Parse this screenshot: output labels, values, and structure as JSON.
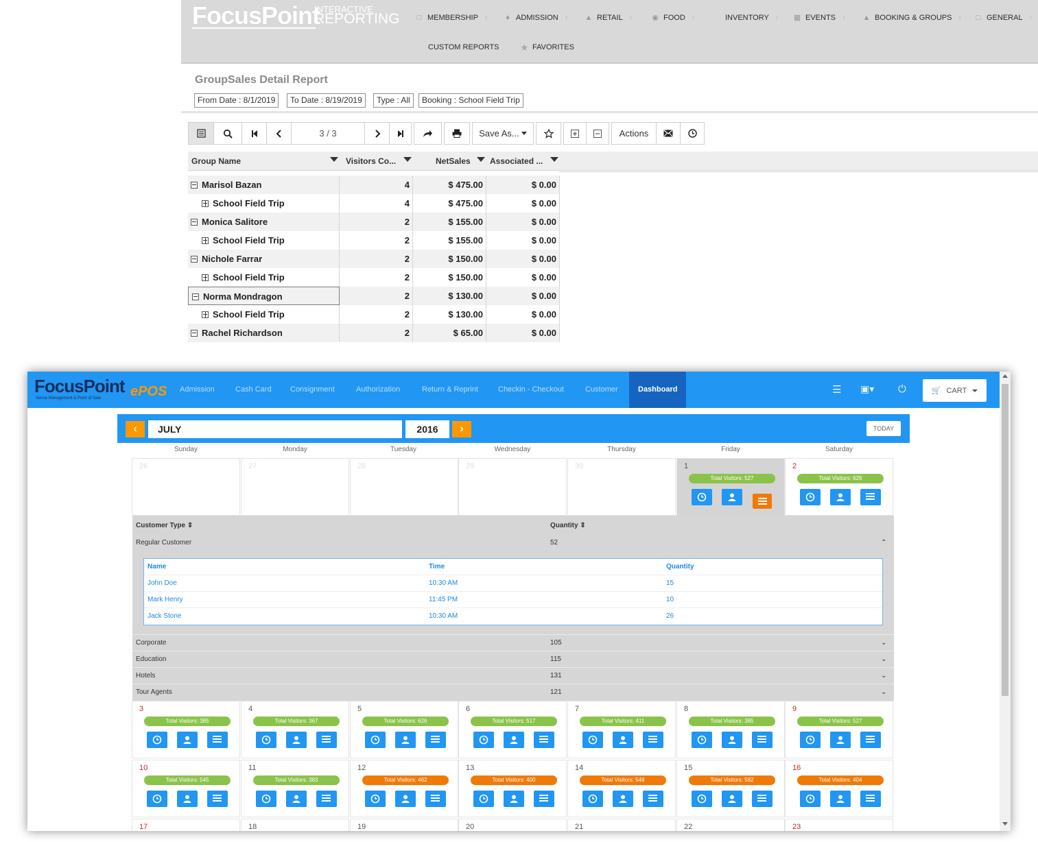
{
  "report": {
    "logo_main": "FocusPoint",
    "logo_small1": "INTERACTIVE",
    "logo_small2": "REPORTING",
    "nav": [
      {
        "label": "MEMBERSHIP",
        "icon": "membership-icon"
      },
      {
        "label": "ADMISSION",
        "icon": "ticket-icon"
      },
      {
        "label": "RETAIL",
        "icon": "shirt-icon"
      },
      {
        "label": "FOOD",
        "icon": "food-icon"
      },
      {
        "label": "INVENTORY",
        "icon": ""
      },
      {
        "label": "EVENTS",
        "icon": "calendar-icon"
      },
      {
        "label": "BOOKING & GROUPS",
        "icon": "booking-icon"
      },
      {
        "label": "GENERAL",
        "icon": "general-icon"
      }
    ],
    "nav2": [
      {
        "label": "CUSTOM REPORTS"
      },
      {
        "label": "FAVORITES",
        "icon": "star-icon"
      }
    ],
    "title": "GroupSales Detail Report",
    "filters": [
      "From Date : 8/1/2019",
      "To Date : 8/19/2019",
      "Type : All",
      "Booking : School Field Trip"
    ],
    "toolbar": {
      "page_current": "3",
      "page_sep": " / ",
      "page_total": "3",
      "save_as": "Save As...",
      "actions": "Actions"
    },
    "columns": [
      "Group Name",
      "Visitors Co...",
      "NetSales",
      "Associated ..."
    ],
    "rows": [
      {
        "type": "parent",
        "name": "Marisol Bazan",
        "visitors": "4",
        "net": "$ 475.00",
        "assoc": "$ 0.00"
      },
      {
        "type": "child",
        "name": "School Field Trip",
        "visitors": "4",
        "net": "$ 475.00",
        "assoc": "$ 0.00"
      },
      {
        "type": "parent",
        "name": "Monica Salitore",
        "visitors": "2",
        "net": "$ 155.00",
        "assoc": "$ 0.00"
      },
      {
        "type": "child",
        "name": "School Field Trip",
        "visitors": "2",
        "net": "$ 155.00",
        "assoc": "$ 0.00"
      },
      {
        "type": "parent",
        "name": "Nichole Farrar",
        "visitors": "2",
        "net": "$ 150.00",
        "assoc": "$ 0.00"
      },
      {
        "type": "child",
        "name": "School Field Trip",
        "visitors": "2",
        "net": "$ 150.00",
        "assoc": "$ 0.00"
      },
      {
        "type": "parent",
        "name": "Norma Mondragon",
        "visitors": "2",
        "net": "$ 130.00",
        "assoc": "$ 0.00"
      },
      {
        "type": "child",
        "name": "School Field Trip",
        "visitors": "2",
        "net": "$ 130.00",
        "assoc": "$ 0.00"
      },
      {
        "type": "parent",
        "name": "Rachel Richardson",
        "visitors": "2",
        "net": "$ 65.00",
        "assoc": "$ 0.00"
      }
    ]
  },
  "pos": {
    "logo_main": "FocusPoint",
    "logo_epos": "ePOS",
    "logo_sub": "Venue Management & Point of Sale",
    "nav": [
      "Admission",
      "Cash Card",
      "Consignment",
      "Authorization",
      "Return & Reprint",
      "Checkin - Checkout",
      "Customer",
      "Dashboard"
    ],
    "active_nav": "Dashboard",
    "cart": "CART",
    "calendar": {
      "month": "JULY",
      "year": "2016",
      "today": "TODAY",
      "weekdays": [
        "Sunday",
        "Monday",
        "Tuesday",
        "Wednesday",
        "Thursday",
        "Friday",
        "Saturday"
      ],
      "week1": [
        {
          "day": "26",
          "state": "dim"
        },
        {
          "day": "27",
          "state": "dim"
        },
        {
          "day": "28",
          "state": "dim"
        },
        {
          "day": "29",
          "state": "dim"
        },
        {
          "day": "30",
          "state": "dim"
        },
        {
          "day": "1",
          "state": "selected",
          "visitors": "Total Visitors: 527",
          "level": "green"
        },
        {
          "day": "2",
          "state": "weekend",
          "visitors": "Total Visitors: 626",
          "level": "green"
        }
      ],
      "week2": [
        {
          "day": "3",
          "visitors": "Total Visitors: 385",
          "level": "green",
          "weekend": true
        },
        {
          "day": "4",
          "visitors": "Total Visitors: 367",
          "level": "green"
        },
        {
          "day": "5",
          "visitors": "Total Visitors: 626",
          "level": "green"
        },
        {
          "day": "6",
          "visitors": "Total Visitors: 517",
          "level": "green"
        },
        {
          "day": "7",
          "visitors": "Total Visitors: 411",
          "level": "green"
        },
        {
          "day": "8",
          "visitors": "Total Visitors: 385",
          "level": "green"
        },
        {
          "day": "9",
          "visitors": "Total Visitors: 527",
          "level": "green",
          "weekend": true
        }
      ],
      "week3": [
        {
          "day": "10",
          "visitors": "Total Visitors: 545",
          "level": "green",
          "weekend": true
        },
        {
          "day": "11",
          "visitors": "Total Visitors: 383",
          "level": "green"
        },
        {
          "day": "12",
          "visitors": "Total Visitors: 462",
          "level": "orange"
        },
        {
          "day": "13",
          "visitors": "Total Visitors: 400",
          "level": "orange"
        },
        {
          "day": "14",
          "visitors": "Total Visitors: 548",
          "level": "orange"
        },
        {
          "day": "15",
          "visitors": "Total Visitors: 582",
          "level": "orange"
        },
        {
          "day": "16",
          "visitors": "Total Visitors: 404",
          "level": "orange",
          "weekend": true
        }
      ],
      "week4": [
        "17",
        "18",
        "19",
        "20",
        "21",
        "22",
        "23"
      ]
    },
    "detail": {
      "col_type": "Customer Type ⇕",
      "col_qty": "Quantity ⇕",
      "expanded": {
        "type": "Regular Customer",
        "qty": "52"
      },
      "sub_headers": [
        "Name",
        "Time",
        "Quantity"
      ],
      "sub_rows": [
        {
          "name": "John Doe",
          "time": "10:30 AM",
          "qty": "15"
        },
        {
          "name": "Mark Henry",
          "time": "11:45 PM",
          "qty": "10"
        },
        {
          "name": "Jack Stone",
          "time": "10:30 AM",
          "qty": "26"
        }
      ],
      "others": [
        {
          "type": "Corporate",
          "qty": "105"
        },
        {
          "type": "Education",
          "qty": "115"
        },
        {
          "type": "Hotels",
          "qty": "131"
        },
        {
          "type": "Tour Agents",
          "qty": "121"
        }
      ]
    }
  },
  "colors": {
    "pos_blue": "#2196f3",
    "pos_orange": "#ef7a0a",
    "pos_green": "#8bc34a",
    "report_header": "#d9d9d9"
  }
}
